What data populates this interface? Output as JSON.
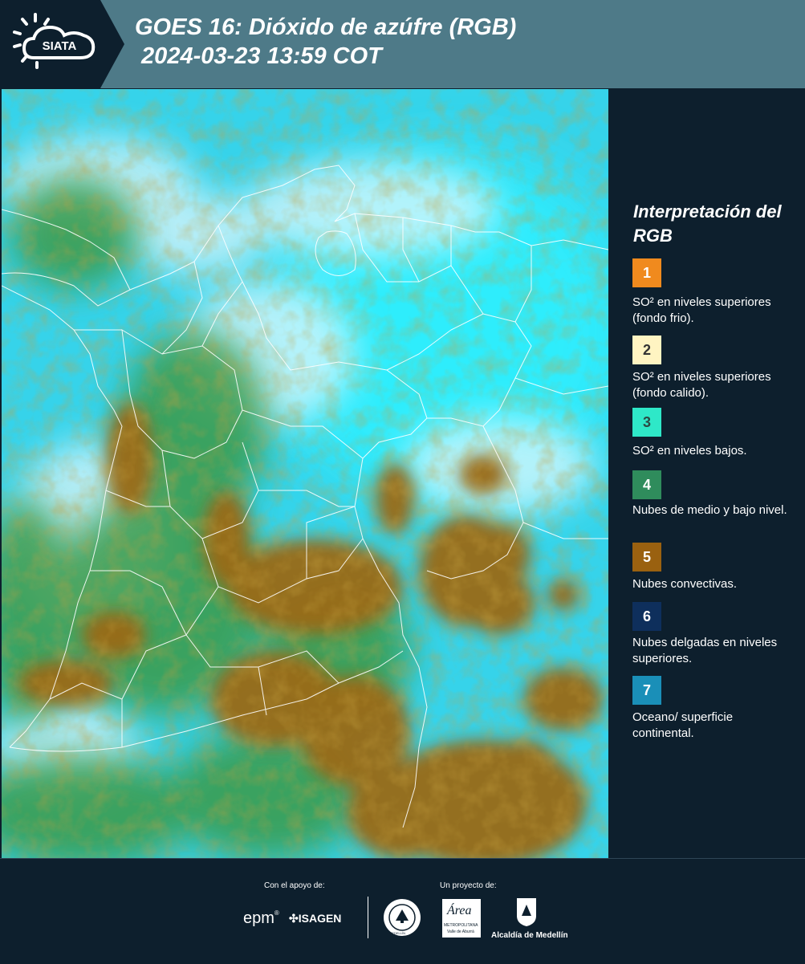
{
  "header": {
    "logo_text": "SIATA",
    "title": "GOES 16: Dióxido de azúfre (RGB)\n 2024-03-23 13:59 COT"
  },
  "legend": {
    "title": "Interpretación del RGB",
    "items": [
      {
        "number": "1",
        "color": "#f08a1e",
        "text_color": "#ffffff",
        "label": "SO² en niveles superiores (fondo frio)."
      },
      {
        "number": "2",
        "color": "#fff4c2",
        "text_color": "#333333",
        "label": "SO² en niveles superiores (fondo calido)."
      },
      {
        "number": "3",
        "color": "#2ee8c8",
        "text_color": "#2b4a44",
        "label": "SO² en niveles bajos."
      },
      {
        "number": "4",
        "color": "#2f8c5c",
        "text_color": "#ffffff",
        "label": "Nubes de medio y bajo nivel."
      },
      {
        "number": "5",
        "color": "#9a6110",
        "text_color": "#ffffff",
        "label": "Nubes convectivas."
      },
      {
        "number": "6",
        "color": "#0e2f5c",
        "text_color": "#ffffff",
        "label": "Nubes delgadas en niveles superiores."
      },
      {
        "number": "7",
        "color": "#1a8fb8",
        "text_color": "#ffffff",
        "label": "Oceano/ superficie continental."
      }
    ]
  },
  "footer": {
    "support_label": "Con el apoyo de:",
    "project_label": "Un proyecto de:",
    "epm": "epm",
    "isagen": "ISAGEN",
    "area_metro": "Área",
    "area_metro_sub": "METROPOLITANA",
    "area_metro_sub2": "Valle de Aburrá",
    "alcaldia": "Alcaldía de Medellín",
    "seal_text": "MEDELLÍN"
  }
}
